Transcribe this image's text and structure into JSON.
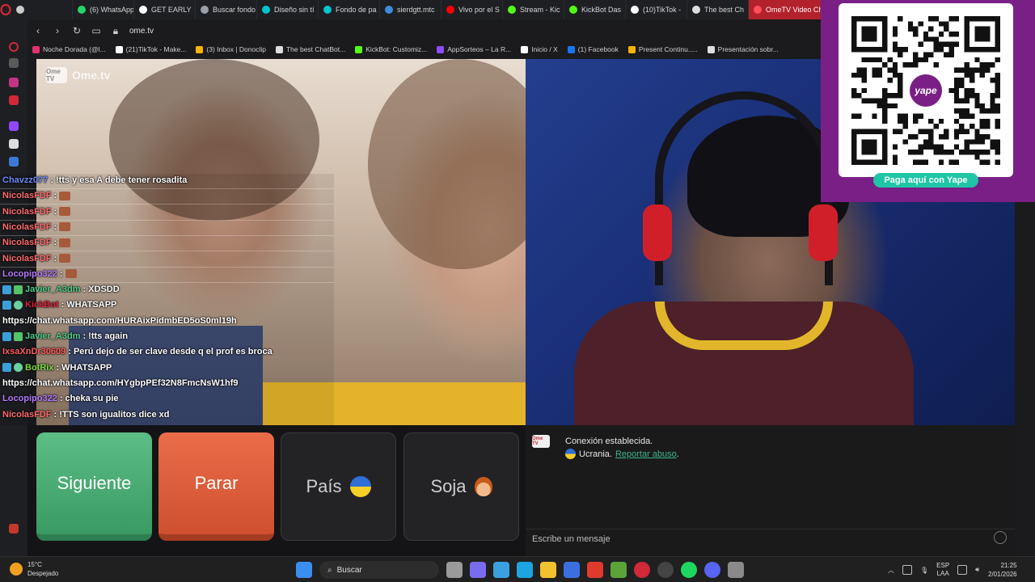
{
  "browser": {
    "tabs": [
      {
        "label": "",
        "color": "#cccccc"
      },
      {
        "label": "(6) WhatsApp",
        "color": "#25d366"
      },
      {
        "label": "GET EARLY",
        "color": "#ffffff"
      },
      {
        "label": "Buscar fondo",
        "color": "#9aa0a6"
      },
      {
        "label": "Diseño sin tí",
        "color": "#00c4cc"
      },
      {
        "label": "Fondo de pa",
        "color": "#00c4cc"
      },
      {
        "label": "sierdgtt.mtc",
        "color": "#3c8dde"
      },
      {
        "label": "Vivo por el S",
        "color": "#ff0000"
      },
      {
        "label": "Stream - Kic",
        "color": "#53fc18"
      },
      {
        "label": "KickBot Das",
        "color": "#53fc18"
      },
      {
        "label": "(10)TikTok -",
        "color": "#ffffff"
      },
      {
        "label": "The best Ch",
        "color": "#dddddd"
      },
      {
        "label": "OmeTV Video Chat",
        "color": "#ff4d5a"
      }
    ],
    "url": "ome.tv",
    "bookmarks": [
      {
        "label": "Noche Dorada (@l...",
        "color": "#e1306c"
      },
      {
        "label": "(21)TikTok - Make...",
        "color": "#ffffff"
      },
      {
        "label": "(3) Inbox | Donoclip",
        "color": "#f5b400"
      },
      {
        "label": "The best ChatBot...",
        "color": "#dddddd"
      },
      {
        "label": "KickBot: Customiz...",
        "color": "#53fc18"
      },
      {
        "label": "AppSorteos – La R...",
        "color": "#8a4dff"
      },
      {
        "label": "Inicio / X",
        "color": "#ffffff"
      },
      {
        "label": "(1) Facebook",
        "color": "#1877f2"
      },
      {
        "label": "Present Continu.....",
        "color": "#f4b400"
      },
      {
        "label": "Presentación sobr...",
        "color": "#dddddd"
      }
    ]
  },
  "video": {
    "logo_badge": "Ome TV",
    "logo_text": "Ome.tv"
  },
  "qr_widget": {
    "badge": "yape",
    "pill": "Paga aquí con Yape"
  },
  "chat": [
    {
      "user": "Chavzz077",
      "color": "#6b8bff",
      "text": "!tts y esa A debe tener rosadita",
      "badges": [],
      "emotes": 0
    },
    {
      "user": "NicolasFDF",
      "color": "#ff6b6b",
      "text": "",
      "badges": [],
      "emotes": 1
    },
    {
      "user": "NicolasFDF",
      "color": "#ff6b6b",
      "text": "",
      "badges": [],
      "emotes": 1
    },
    {
      "user": "NicolasFDF",
      "color": "#ff6b6b",
      "text": "",
      "badges": [],
      "emotes": 1
    },
    {
      "user": "NicolasFDF",
      "color": "#ff6b6b",
      "text": "",
      "badges": [],
      "emotes": 1
    },
    {
      "user": "NicolasFDF",
      "color": "#ff6b6b",
      "text": "",
      "badges": [],
      "emotes": 1
    },
    {
      "user": "Locopipo322",
      "color": "#b57bff",
      "text": "",
      "badges": [],
      "emotes": 1
    },
    {
      "user": "Javier_A3dm",
      "color": "#4fd08a",
      "text": "XDSDD",
      "badges": [
        "b1",
        "b3"
      ],
      "emotes": 0
    },
    {
      "user": "KickBot",
      "color": "#e0203a",
      "text": "WHATSAPP",
      "badges": [
        "b1",
        "b2"
      ],
      "emotes": 0
    },
    {
      "user": "",
      "color": "#ffffff",
      "text": "https://chat.whatsapp.com/HURAixPidmbED5oS0ml19h",
      "badges": [],
      "emotes": 0
    },
    {
      "user": "Javier_A3dm",
      "color": "#4fd08a",
      "text": "!tts again",
      "badges": [
        "b1",
        "b3"
      ],
      "emotes": 0
    },
    {
      "user": "IxsaXnDr30609",
      "color": "#ff5d5d",
      "text": "Perú dejo de ser clave desde q el prof es broca",
      "badges": [],
      "emotes": 0
    },
    {
      "user": "BotRix",
      "color": "#7bdc3c",
      "text": "WHATSAPP",
      "badges": [
        "b1",
        "b2"
      ],
      "emotes": 0
    },
    {
      "user": "",
      "color": "#ffffff",
      "text": "https://chat.whatsapp.com/HYgbpPEf32N8FmcNsW1hf9",
      "badges": [],
      "emotes": 0
    },
    {
      "user": "Locopipo322",
      "color": "#b57bff",
      "text": "cheka su pie",
      "badges": [],
      "emotes": 0
    },
    {
      "user": "NicolasFDF",
      "color": "#ff6b6b",
      "text": "!TTS son igualitos dice xd",
      "badges": [],
      "emotes": 0
    }
  ],
  "controls": {
    "next": "Siguiente",
    "stop": "Parar",
    "country": "País",
    "gender": "Soja"
  },
  "text_chat": {
    "logo": "Ome TV",
    "status": "Conexión establecida.",
    "country": "Ucrania.",
    "report_link": "Reportar abuso",
    "report_suffix": ".",
    "input_placeholder": "Escribe un mensaje"
  },
  "taskbar": {
    "temp": "15°C",
    "weather": "Despejado",
    "search_label": "Buscar",
    "lang1": "ESP",
    "lang2": "LAA",
    "time": "21:25",
    "date": "2/01/2026",
    "apps": [
      {
        "name": "start",
        "color": "#3a8ef0"
      },
      {
        "name": "task-view",
        "color": "#9a9a9a"
      },
      {
        "name": "copilot",
        "color": "#7a6cf0"
      },
      {
        "name": "widgets",
        "color": "#3aa0e0"
      },
      {
        "name": "edge",
        "color": "#1ca5e0"
      },
      {
        "name": "explorer",
        "color": "#f2c12e"
      },
      {
        "name": "store",
        "color": "#3b6fe0"
      },
      {
        "name": "office",
        "color": "#e03a2e"
      },
      {
        "name": "minecraft",
        "color": "#5aa43a"
      },
      {
        "name": "opera",
        "color": "#d1283a"
      },
      {
        "name": "obs",
        "color": "#444444"
      },
      {
        "name": "spotify",
        "color": "#1ed760"
      },
      {
        "name": "discord",
        "color": "#5865f2"
      },
      {
        "name": "settings",
        "color": "#8a8a8a"
      }
    ]
  }
}
